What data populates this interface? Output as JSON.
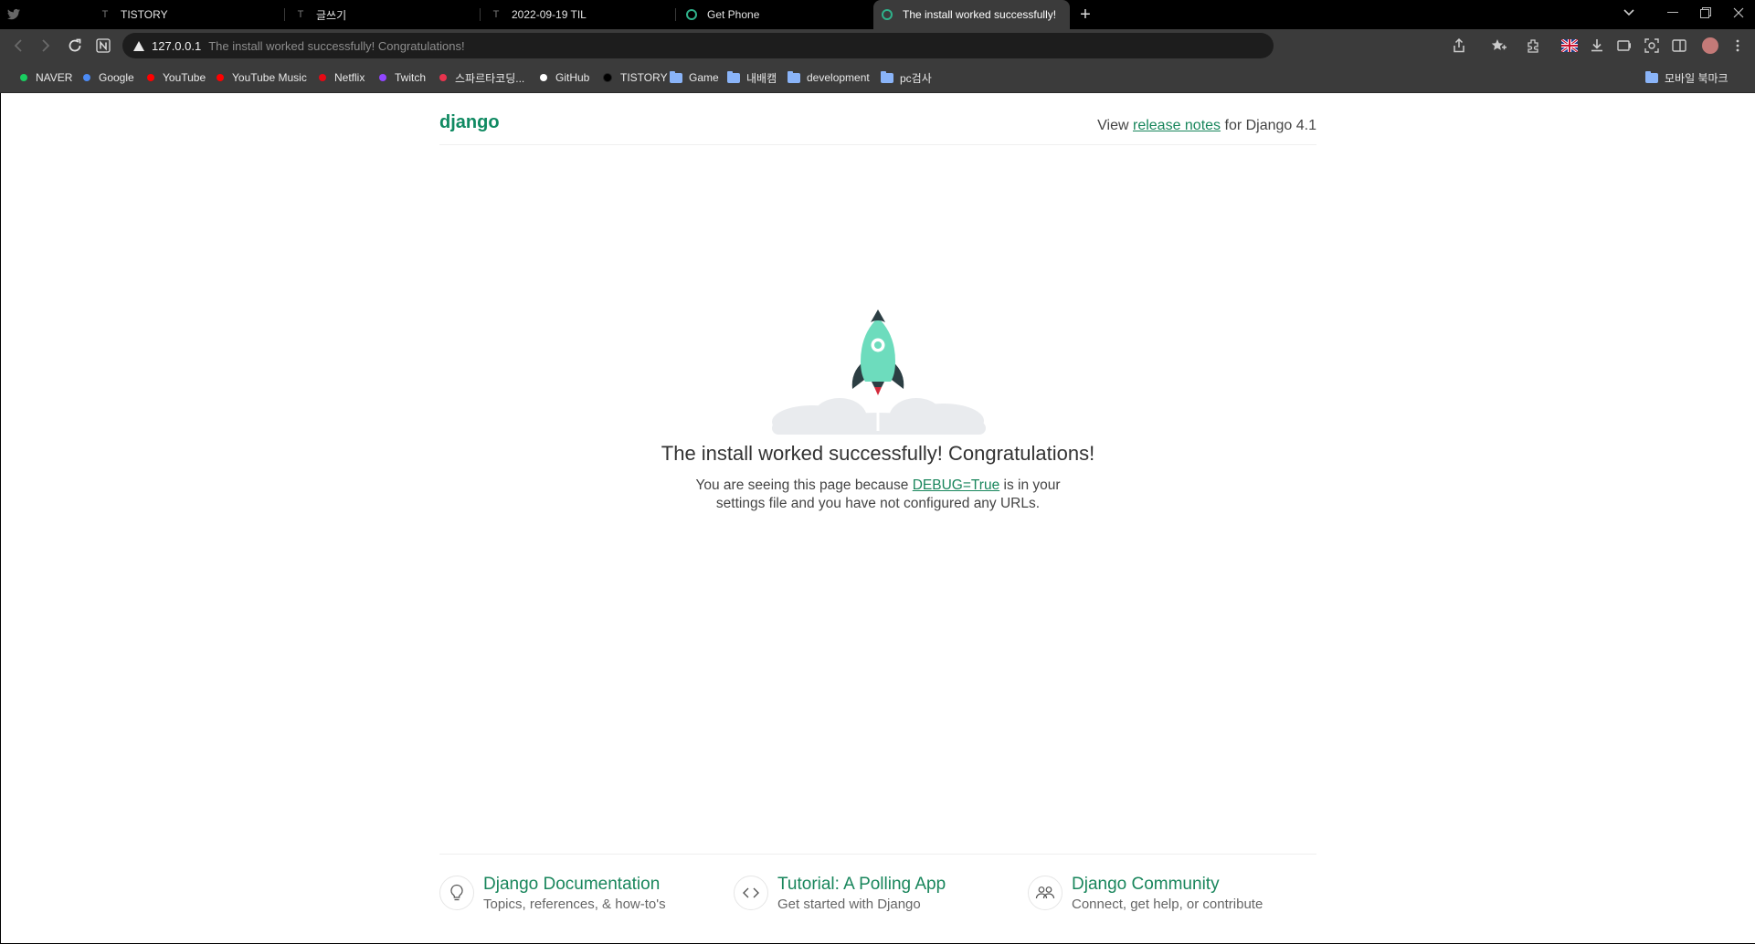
{
  "browser": {
    "tabs": [
      {
        "label": "",
        "icon": "twitter-icon"
      },
      {
        "label": "TISTORY",
        "icon": "tistory-icon"
      },
      {
        "label": "글쓰기",
        "icon": "tistory-icon"
      },
      {
        "label": "2022-09-19 TIL",
        "icon": "tistory-icon"
      },
      {
        "label": "Get Phone",
        "icon": "django-ring-icon"
      },
      {
        "label": "The install worked successfully!",
        "icon": "django-ring-icon",
        "active": true
      }
    ],
    "new_tab_label": "+",
    "address": {
      "host": "127.0.0.1",
      "page_title": "The install worked successfully! Congratulations!"
    },
    "bookmarks": [
      {
        "label": "NAVER",
        "icon": "naver-icon",
        "color": "#19ce60"
      },
      {
        "label": "Google",
        "icon": "google-icon",
        "color": "#4285f4"
      },
      {
        "label": "YouTube",
        "icon": "youtube-icon",
        "color": "#ff0000"
      },
      {
        "label": "YouTube Music",
        "icon": "youtube-music-icon",
        "color": "#ff0000"
      },
      {
        "label": "Netflix",
        "icon": "netflix-icon",
        "color": "#e50914"
      },
      {
        "label": "Twitch",
        "icon": "twitch-icon",
        "color": "#9146ff"
      },
      {
        "label": "스파르타코딩...",
        "icon": "sparta-icon",
        "color": "#e8344e"
      },
      {
        "label": "GitHub",
        "icon": "github-icon",
        "color": "#ffffff"
      },
      {
        "label": "TISTORY",
        "icon": "tistory-icon",
        "color": "#000000"
      },
      {
        "label": "Game",
        "icon": "folder-icon"
      },
      {
        "label": "내배캠",
        "icon": "folder-icon"
      },
      {
        "label": "development",
        "icon": "folder-icon"
      },
      {
        "label": "pc검사",
        "icon": "folder-icon"
      }
    ],
    "mobile_bookmarks": "모바일 북마크"
  },
  "page": {
    "logo": "django",
    "release": {
      "prefix": "View ",
      "link": "release notes",
      "suffix": " for Django 4.1"
    },
    "title": "The install worked successfully! Congratulations!",
    "subtitle": {
      "prefix": "You are seeing this page because ",
      "link": "DEBUG=True",
      "suffix": " is in your settings file and you have not configured any URLs."
    },
    "cards": [
      {
        "title": "Django Documentation",
        "desc": "Topics, references, & how-to's",
        "icon": "lightbulb-icon"
      },
      {
        "title": "Tutorial: A Polling App",
        "desc": "Get started with Django",
        "icon": "code-icon"
      },
      {
        "title": "Django Community",
        "desc": "Connect, get help, or contribute",
        "icon": "people-icon"
      }
    ]
  },
  "colors": {
    "django_green": "#19865c",
    "rocket_body": "#6ddcbd",
    "rocket_fins": "#2c3e43",
    "cloud": "#e9ebee"
  }
}
